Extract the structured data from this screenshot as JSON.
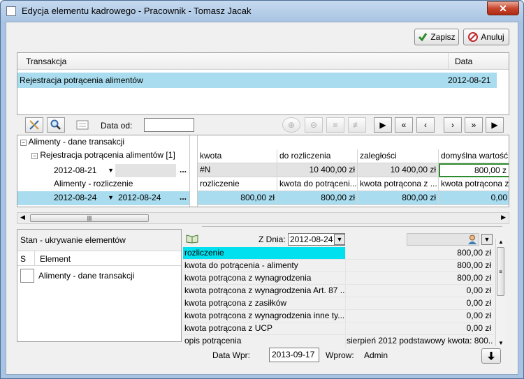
{
  "window": {
    "title": "Edycja elementu kadrowego - Pracownik - Tomasz Jacak",
    "close": "✕"
  },
  "toolbar": {
    "save_label": "Zapisz",
    "cancel_label": "Anuluj"
  },
  "transactions": {
    "headers": {
      "name": "Transakcja",
      "date": "Data"
    },
    "rows": [
      {
        "name": "Rejestracja potrącenia alimentów",
        "date": "2012-08-21"
      }
    ]
  },
  "filter": {
    "date_from_label": "Data od:",
    "date_from_value": ""
  },
  "tree": {
    "root": "Alimenty - dane transakcji",
    "child": "Rejestracja potrącenia alimentów [1]",
    "child_date": "2012-08-21",
    "child_ellipsis": "...",
    "sub": "Alimenty - rozliczenie",
    "sub_date1": "2012-08-24",
    "sub_date2": "2012-08-24",
    "sub_ellipsis": "..."
  },
  "grid": {
    "row1": {
      "col1": "kwota",
      "col2": "do rozliczenia",
      "col3": "zaległości",
      "col4": "domyślna wartość ..."
    },
    "row2": {
      "col1": "#N",
      "col2": "10 400,00 zł",
      "col3": "10 400,00 zł",
      "col4": "800,00 z"
    },
    "row3": {
      "col1": "rozliczenie",
      "col2": "kwota do potrąceni...",
      "col3": "kwota potrącona z ...",
      "col4": "kwota potrącona z ..."
    },
    "row4": {
      "col1": "800,00 zł",
      "col2": "800,00 zł",
      "col3": "800,00 zł",
      "col4": "0,00"
    }
  },
  "state_panel": {
    "title": "Stan - ukrywanie elementów",
    "col_s": "S",
    "col_element": "Element",
    "items": [
      {
        "label": "Alimenty - dane transakcji"
      }
    ]
  },
  "props": {
    "date_label": "Z Dnia:",
    "date_value": "2012-08-24",
    "rows": [
      {
        "label": "rozliczenie",
        "value": "800,00 zł"
      },
      {
        "label": "kwota do potrącenia - alimenty",
        "value": "800,00 zł"
      },
      {
        "label": "kwota potrącona z wynagrodzenia",
        "value": "800,00 zł"
      },
      {
        "label": "kwota potrącona z wynagrodzenia Art. 87 ...",
        "value": "0,00 zł"
      },
      {
        "label": "kwota potrącona z zasiłków",
        "value": "0,00 zł"
      },
      {
        "label": "kwota potrącona z wynagrodzenia inne ty...",
        "value": "0,00 zł"
      },
      {
        "label": "kwota potrącona z UCP",
        "value": "0,00 zł"
      },
      {
        "label": "opis potrącenia",
        "value": "sierpień 2012 podstawowy kwota: 800..."
      }
    ]
  },
  "footer": {
    "entry_date_label": "Data Wpr:",
    "entry_date_value": "2013-09-17",
    "entered_by_label": "Wprow:",
    "entered_by_value": "Admin"
  },
  "colors": {
    "selection": "#a8dcee",
    "accent_green": "#2e8b2e"
  }
}
